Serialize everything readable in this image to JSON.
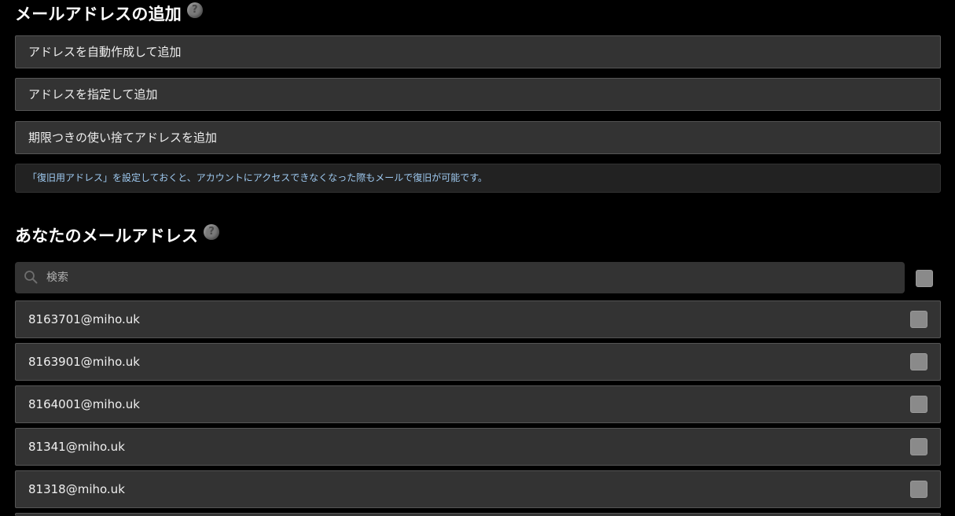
{
  "add_section": {
    "title": "メールアドレスの追加",
    "help_icon": "?",
    "buttons": [
      {
        "label": "アドレスを自動作成して追加"
      },
      {
        "label": "アドレスを指定して追加"
      },
      {
        "label": "期限つきの使い捨てアドレスを追加"
      }
    ],
    "info_text": "「復旧用アドレス」を設定しておくと、アカウントにアクセスできなくなった際もメールで復旧が可能です。",
    "info_color": "#9ec9f0"
  },
  "address_section": {
    "title": "あなたのメールアドレス",
    "help_icon": "?",
    "search": {
      "placeholder": "検索",
      "value": ""
    },
    "emails": [
      {
        "address": "8163701@miho.uk"
      },
      {
        "address": "8163901@miho.uk"
      },
      {
        "address": "8164001@miho.uk"
      },
      {
        "address": "81341@miho.uk"
      },
      {
        "address": "81318@miho.uk"
      }
    ]
  },
  "colors": {
    "background": "#000000",
    "panel": "#333333",
    "checkbox": "#8a8a8a"
  }
}
